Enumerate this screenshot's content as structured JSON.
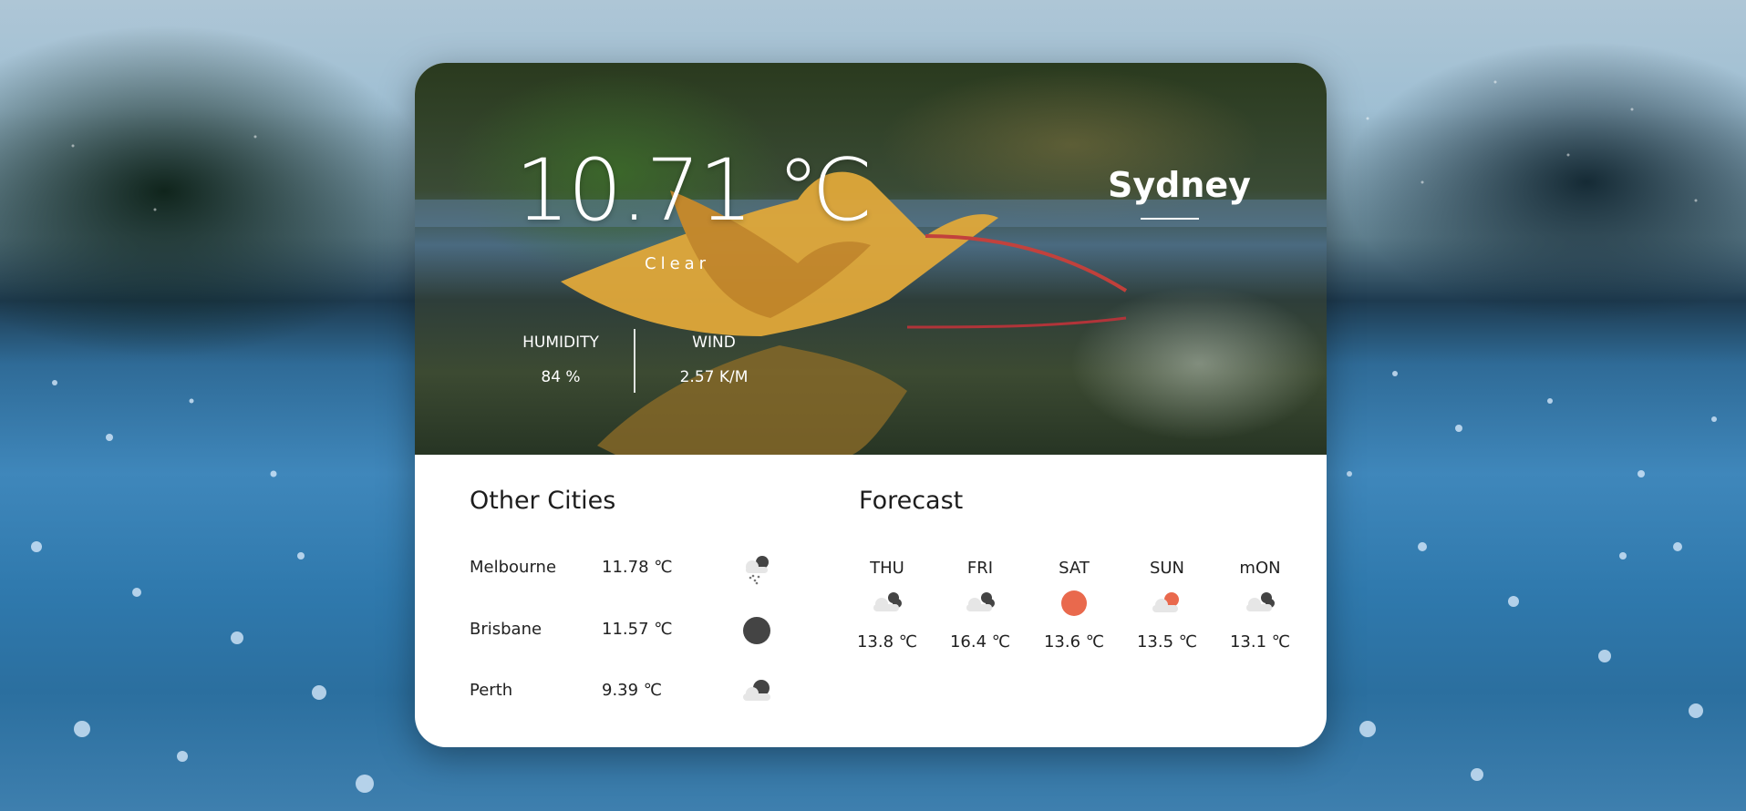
{
  "current": {
    "temperature": "10.71 ℃",
    "condition": "Clear",
    "city": "Sydney",
    "humidity_label": "HUMIDITY",
    "humidity_value": "84 %",
    "wind_label": "WIND",
    "wind_value": "2.57 K/M"
  },
  "other_cities": {
    "title": "Other Cities",
    "items": [
      {
        "name": "Melbourne",
        "temp": "11.78 ℃",
        "icon": "snow-cloud-icon"
      },
      {
        "name": "Brisbane",
        "temp": "11.57 ℃",
        "icon": "dark-circle-icon"
      },
      {
        "name": "Perth",
        "temp": "9.39 ℃",
        "icon": "partly-cloudy-icon"
      }
    ]
  },
  "forecast": {
    "title": "Forecast",
    "days": [
      {
        "day": "THU",
        "temp": "13.8 ℃",
        "icon": "broken-clouds-icon"
      },
      {
        "day": "FRI",
        "temp": "16.4 ℃",
        "icon": "broken-clouds-icon"
      },
      {
        "day": "SAT",
        "temp": "13.6 ℃",
        "icon": "sun-icon"
      },
      {
        "day": "SUN",
        "temp": "13.5 ℃",
        "icon": "sun-cloud-icon"
      },
      {
        "day": "mON",
        "temp": "13.1 ℃",
        "icon": "broken-clouds-icon"
      }
    ]
  },
  "colors": {
    "sun": "#e9694d",
    "icon_dark": "#444444",
    "icon_light": "#e6e6e6"
  }
}
